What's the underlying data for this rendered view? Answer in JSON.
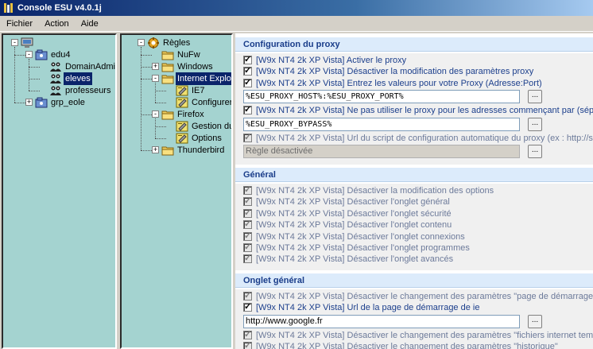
{
  "window": {
    "title": "Console ESU v4.0.1j"
  },
  "menu": [
    "Fichier",
    "Action",
    "Aide"
  ],
  "groups_tree": [
    {
      "label": "",
      "level": 0,
      "expander": "-",
      "icon": "computer-icon"
    },
    {
      "label": "edu4",
      "level": 1,
      "expander": "-",
      "icon": "group-icon"
    },
    {
      "label": "DomainAdmins",
      "level": 2,
      "expander": "",
      "icon": "users-icon"
    },
    {
      "label": "eleves",
      "level": 2,
      "expander": "",
      "icon": "users-icon",
      "selected": true
    },
    {
      "label": "professeurs",
      "level": 2,
      "expander": "",
      "icon": "users-icon"
    },
    {
      "label": "grp_eole",
      "level": 1,
      "expander": "+",
      "icon": "group-icon"
    }
  ],
  "rules_tree": [
    {
      "label": "Règles",
      "level": 0,
      "expander": "-",
      "icon": "gear-icon"
    },
    {
      "label": "NuFw",
      "level": 1,
      "expander": "",
      "icon": "folder-icon"
    },
    {
      "label": "Windows",
      "level": 1,
      "expander": "+",
      "icon": "folder-icon"
    },
    {
      "label": "Internet Explorer",
      "level": 1,
      "expander": "-",
      "icon": "folder-icon",
      "selected": true
    },
    {
      "label": "IE7",
      "level": 2,
      "expander": "",
      "icon": "rule-icon"
    },
    {
      "label": "Configurer les b",
      "level": 2,
      "expander": "",
      "icon": "rule-icon"
    },
    {
      "label": "Firefox",
      "level": 1,
      "expander": "-",
      "icon": "folder-icon"
    },
    {
      "label": "Gestion du profi",
      "level": 2,
      "expander": "",
      "icon": "rule-icon"
    },
    {
      "label": "Options",
      "level": 2,
      "expander": "",
      "icon": "rule-icon"
    },
    {
      "label": "Thunderbird",
      "level": 1,
      "expander": "+",
      "icon": "folder-icon"
    }
  ],
  "sections": [
    {
      "title": "Configuration du proxy",
      "items": [
        {
          "type": "checkbox",
          "checked": true,
          "enabled": true,
          "text": "[W9x NT4 2k XP Vista] Activer le proxy"
        },
        {
          "type": "checkbox",
          "checked": true,
          "enabled": true,
          "text": "[W9x NT4 2k XP Vista] Désactiver la modification des paramètres proxy"
        },
        {
          "type": "checkbox",
          "checked": true,
          "enabled": true,
          "text": "[W9x NT4 2k XP Vista] Entrez les valeurs pour votre Proxy (Adresse:Port)"
        },
        {
          "type": "field",
          "value": "%ESU_PROXY_HOST%:%ESU_PROXY_PORT%",
          "mono": true,
          "enabled": true,
          "button": "..."
        },
        {
          "type": "checkbox",
          "checked": true,
          "enabled": true,
          "text": "[W9x NT4 2k XP Vista] Ne pas utiliser le proxy pour les adresses commençant par (séparateur = ;"
        },
        {
          "type": "field",
          "value": "%ESU_PROXY_BYPASS%",
          "mono": true,
          "enabled": true,
          "button": "..."
        },
        {
          "type": "checkbox",
          "checked": true,
          "enabled": false,
          "text": "[W9x NT4 2k XP Vista] Url du script de configuration automatique du proxy (ex : http://srvproxy/c"
        },
        {
          "type": "field",
          "value": "Règle désactivée",
          "mono": false,
          "enabled": false,
          "button": "..."
        }
      ]
    },
    {
      "title": "Général",
      "items": [
        {
          "type": "checkbox",
          "checked": true,
          "enabled": false,
          "text": "[W9x NT4 2k XP Vista] Désactiver la modification des options"
        },
        {
          "type": "checkbox",
          "checked": true,
          "enabled": false,
          "text": "[W9x NT4 2k XP Vista] Désactiver l'onglet général"
        },
        {
          "type": "checkbox",
          "checked": true,
          "enabled": false,
          "text": "[W9x NT4 2k XP Vista] Désactiver l'onglet sécurité"
        },
        {
          "type": "checkbox",
          "checked": true,
          "enabled": false,
          "text": "[W9x NT4 2k XP Vista] Désactiver l'onglet contenu"
        },
        {
          "type": "checkbox",
          "checked": true,
          "enabled": false,
          "text": "[W9x NT4 2k XP Vista] Désactiver l'onglet connexions"
        },
        {
          "type": "checkbox",
          "checked": true,
          "enabled": false,
          "text": "[W9x NT4 2k XP Vista] Désactiver l'onglet programmes"
        },
        {
          "type": "checkbox",
          "checked": true,
          "enabled": false,
          "text": "[W9x NT4 2k XP Vista] Désactiver l'onglet avancés"
        }
      ]
    },
    {
      "title": "Onglet général",
      "items": [
        {
          "type": "checkbox",
          "checked": true,
          "enabled": false,
          "text": "[W9x NT4 2k XP Vista] Désactiver le changement des paramètres \"page de démarrage\""
        },
        {
          "type": "checkbox",
          "checked": true,
          "enabled": true,
          "text": "[W9x NT4 2k XP Vista] Url de la page de démarrage de ie"
        },
        {
          "type": "field",
          "value": "http://www.google.fr",
          "mono": false,
          "enabled": true,
          "button": "..."
        },
        {
          "type": "checkbox",
          "checked": true,
          "enabled": false,
          "text": "[W9x NT4 2k XP Vista] Désactiver le changement des paramètres \"fichiers internet temporaires\""
        },
        {
          "type": "checkbox",
          "checked": true,
          "enabled": false,
          "text": "[W9x NT4 2k XP Vista] Désactiver le changement des paramètres \"historique\""
        }
      ]
    }
  ]
}
